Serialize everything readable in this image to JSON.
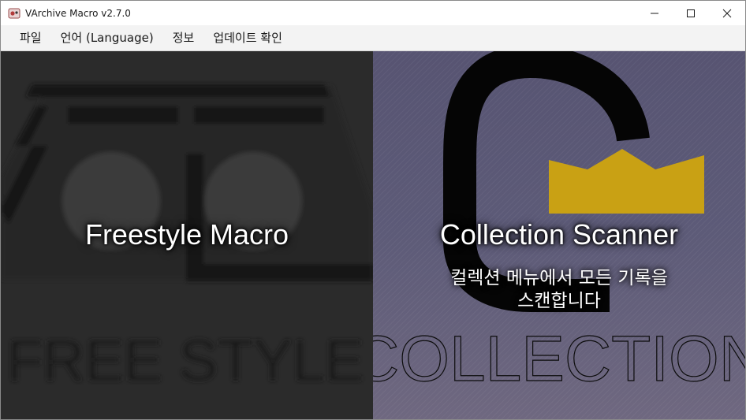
{
  "window": {
    "title": "VArchive Macro v2.7.0",
    "controls": {
      "minimize": "–",
      "maximize": "☐",
      "close": "✕"
    }
  },
  "menu": {
    "items": [
      {
        "id": "file",
        "label": "파일"
      },
      {
        "id": "language",
        "label": "언어 (Language)"
      },
      {
        "id": "info",
        "label": "정보"
      },
      {
        "id": "update",
        "label": "업데이트 확인"
      }
    ]
  },
  "panels": {
    "freestyle": {
      "title": "Freestyle Macro",
      "watermark": "FREE STYLE"
    },
    "collection": {
      "title": "Collection Scanner",
      "description_line1": "컬렉션 메뉴에서 모든 기록을",
      "description_line2": "스캔합니다",
      "watermark": "COLLECTION",
      "accent_color": "#c9a114"
    }
  }
}
